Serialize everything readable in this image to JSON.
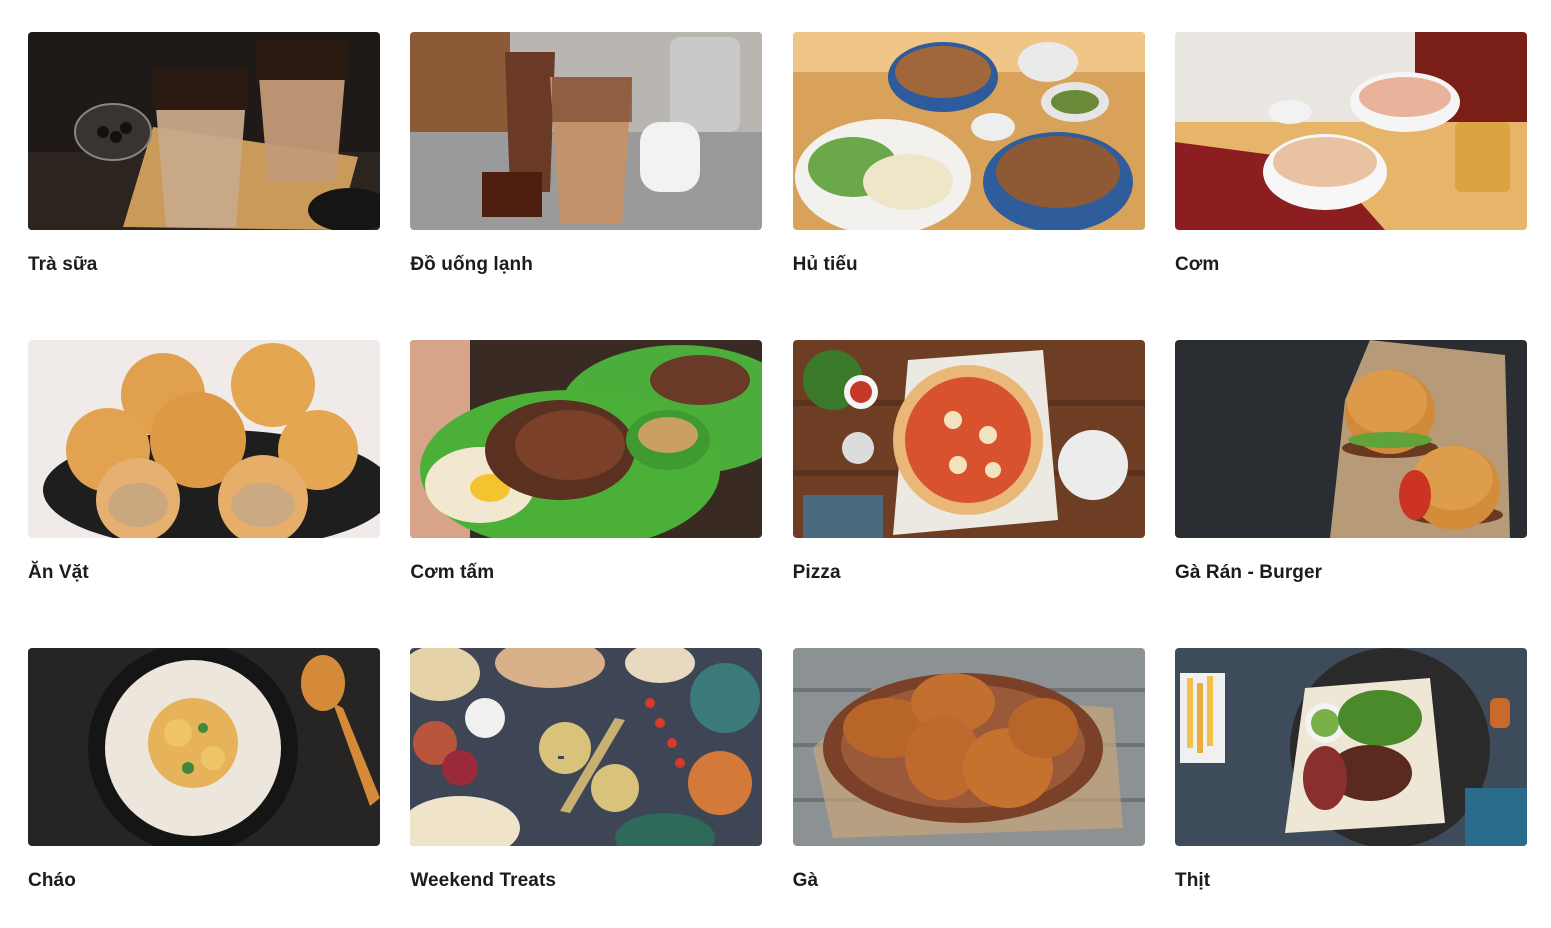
{
  "categories": [
    {
      "label": "Trà sữa",
      "image": "bubble-milk-tea-photo"
    },
    {
      "label": "Đồ uống lạnh",
      "image": "iced-coffee-photo"
    },
    {
      "label": "Hủ tiếu",
      "image": "noodle-soup-photo"
    },
    {
      "label": "Cơm",
      "image": "fried-rice-photo"
    },
    {
      "label": "Ăn Vặt",
      "image": "fried-buns-photo"
    },
    {
      "label": "Cơm tấm",
      "image": "broken-rice-pork-chop-photo"
    },
    {
      "label": "Pizza",
      "image": "pizza-photo"
    },
    {
      "label": "Gà Rán - Burger",
      "image": "burgers-photo"
    },
    {
      "label": "Cháo",
      "image": "rice-porridge-photo"
    },
    {
      "label": "Weekend Treats",
      "image": "party-spread-photo"
    },
    {
      "label": "Gà",
      "image": "roast-chicken-photo"
    },
    {
      "label": "Thịt",
      "image": "steak-photo"
    }
  ]
}
